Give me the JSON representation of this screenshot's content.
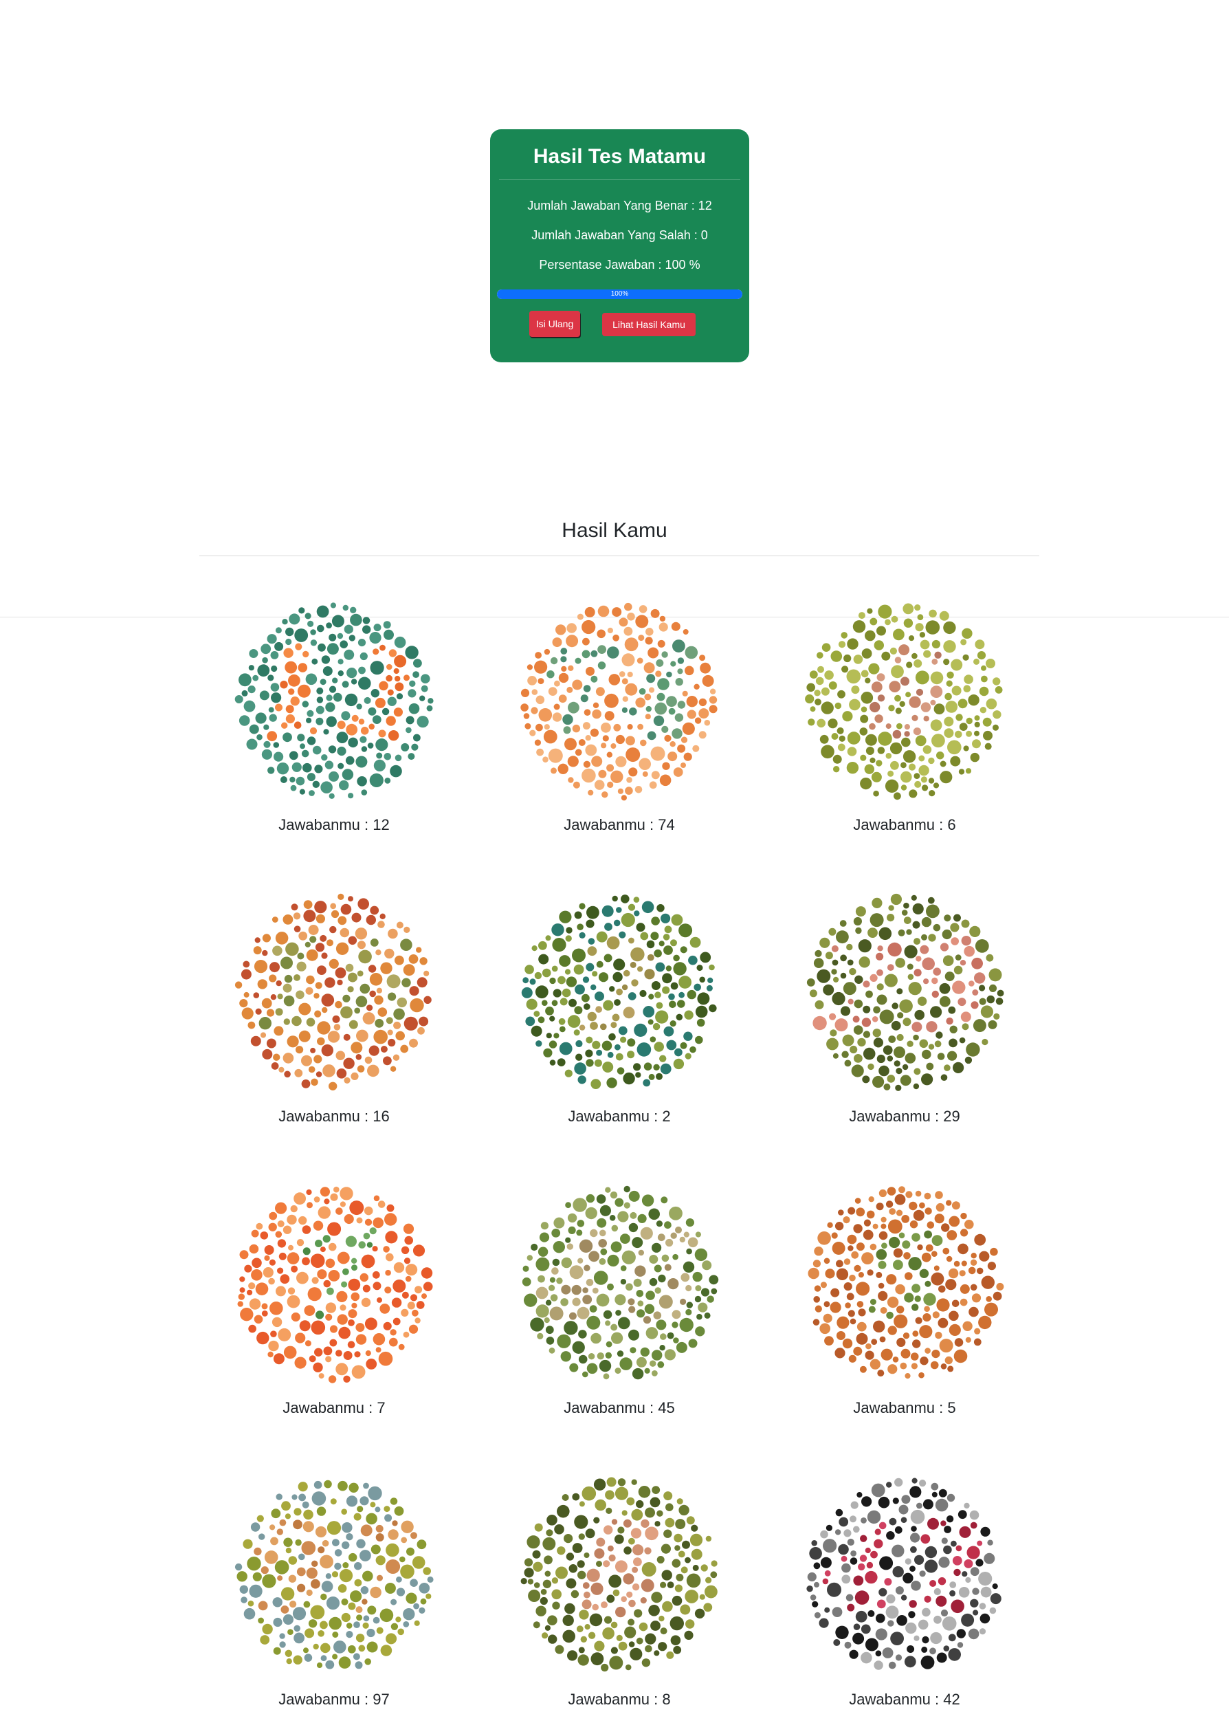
{
  "result_card": {
    "title": "Hasil Tes Matamu",
    "correct_text": "Jumlah Jawaban Yang Benar : 12",
    "wrong_text": "Jumlah Jawaban Yang Salah : 0",
    "percentage_text": "Persentase Jawaban : 100 %",
    "progress": {
      "value": 100,
      "label": "100%"
    },
    "buttons": {
      "refill": "Isi Ulang",
      "view": "Lihat Hasil Kamu"
    },
    "colors": {
      "card": "#198754",
      "progress": "#0d6efd",
      "button": "#dc3545"
    }
  },
  "results_section": {
    "title": "Hasil Kamu",
    "plates": [
      {
        "caption": "Jawabanmu : 12",
        "plate_number": "12",
        "bg": [
          "#3d8a72",
          "#2f7a64",
          "#4a9680"
        ],
        "fg": [
          "#f07a36",
          "#e8692a",
          "#f58a45"
        ]
      },
      {
        "caption": "Jawabanmu : 74",
        "plate_number": "74",
        "bg": [
          "#f09a5a",
          "#e8803c",
          "#f5b27a"
        ],
        "fg": [
          "#4a8a70",
          "#5c9a72",
          "#6fa07a"
        ]
      },
      {
        "caption": "Jawabanmu : 6",
        "plate_number": "6",
        "bg": [
          "#9aa83a",
          "#7d8a2a",
          "#b5bd55"
        ],
        "fg": [
          "#c9866a",
          "#b87660",
          "#d69a80"
        ]
      },
      {
        "caption": "Jawabanmu : 16",
        "plate_number": "16",
        "bg": [
          "#e0883a",
          "#c2502e",
          "#eba060"
        ],
        "fg": [
          "#9a9a4a",
          "#7a8a40",
          "#b0a860"
        ]
      },
      {
        "caption": "Jawabanmu : 2",
        "plate_number": "2",
        "bg": [
          "#5a7a2a",
          "#3e5a1e",
          "#8aa040",
          "#2a7a70"
        ],
        "fg": [
          "#a89a50",
          "#b8a060",
          "#9a8a48"
        ]
      },
      {
        "caption": "Jawabanmu : 29",
        "plate_number": "29",
        "bg": [
          "#6a7a30",
          "#8a9640",
          "#4a5a22"
        ],
        "fg": [
          "#d08070",
          "#c87060",
          "#e0907c"
        ]
      },
      {
        "caption": "Jawabanmu : 7",
        "plate_number": "7",
        "bg": [
          "#f07a3a",
          "#e85a2a",
          "#f5a060"
        ],
        "fg": [
          "#5a9a50",
          "#4a8a44",
          "#6fa860"
        ]
      },
      {
        "caption": "Jawabanmu : 45",
        "plate_number": "45",
        "bg": [
          "#6a8a3a",
          "#9aa860",
          "#4a6a2a"
        ],
        "fg": [
          "#b0a070",
          "#a08a60",
          "#c0b080"
        ]
      },
      {
        "caption": "Jawabanmu : 5",
        "plate_number": "5",
        "bg": [
          "#d07030",
          "#b85a28",
          "#e08a48"
        ],
        "fg": [
          "#6a8a3a",
          "#5a7a30",
          "#7a9a48"
        ]
      },
      {
        "caption": "Jawabanmu : 97",
        "plate_number": "97",
        "bg": [
          "#a8a83a",
          "#8a9a30",
          "#7a9aa0"
        ],
        "fg": [
          "#d08a50",
          "#c07a40",
          "#e0a060"
        ]
      },
      {
        "caption": "Jawabanmu : 8",
        "plate_number": "8",
        "bg": [
          "#6a7a30",
          "#9aa040",
          "#4a5a22"
        ],
        "fg": [
          "#d09070",
          "#c08060",
          "#e0a080"
        ]
      },
      {
        "caption": "Jawabanmu : 42",
        "plate_number": "42",
        "bg": [
          "#1a1a1a",
          "#7a7a7a",
          "#b0b0b0",
          "#404040"
        ],
        "fg": [
          "#c0304a",
          "#d04060",
          "#a02038"
        ]
      }
    ]
  }
}
